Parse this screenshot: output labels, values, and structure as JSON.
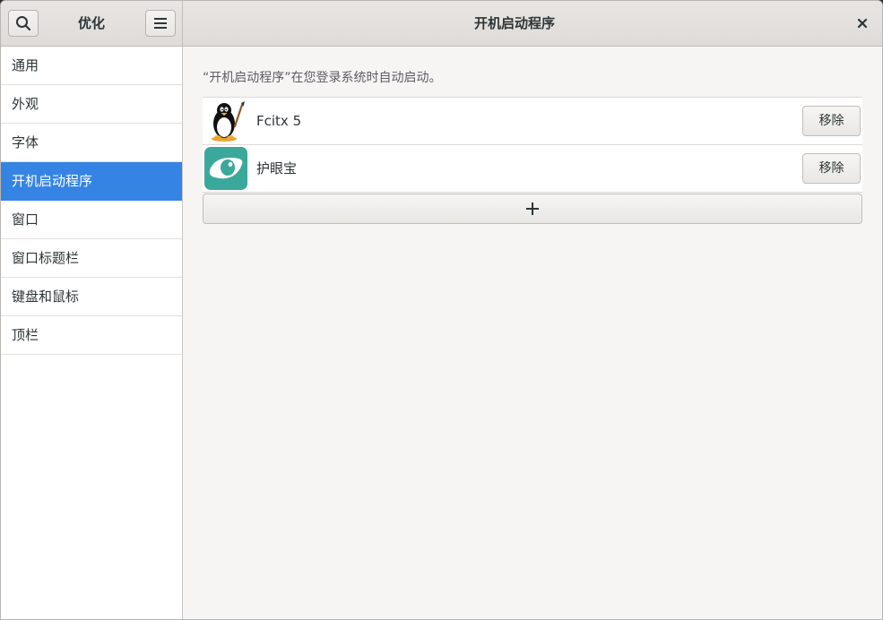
{
  "header": {
    "sidebar_title": "优化",
    "title": "开机启动程序",
    "search_icon": "search-icon",
    "menu_icon": "hamburger-menu-icon",
    "close_icon": "close-icon"
  },
  "sidebar": {
    "items": [
      {
        "label": "通用",
        "active": false
      },
      {
        "label": "外观",
        "active": false
      },
      {
        "label": "字体",
        "active": false
      },
      {
        "label": "开机启动程序",
        "active": true
      },
      {
        "label": "窗口",
        "active": false
      },
      {
        "label": "窗口标题栏",
        "active": false
      },
      {
        "label": "键盘和鼠标",
        "active": false
      },
      {
        "label": "顶栏",
        "active": false
      }
    ]
  },
  "main": {
    "description": "“开机启动程序”在您登录系统时自动启动。",
    "apps": [
      {
        "name": "Fcitx 5",
        "icon": "tux-penguin-icon",
        "remove_label": "移除"
      },
      {
        "name": "护眼宝",
        "icon": "eye-icon",
        "remove_label": "移除"
      }
    ],
    "add_icon": "plus-icon"
  },
  "colors": {
    "accent": "#3584e4",
    "eye_icon_bg": "#3aa89b"
  }
}
